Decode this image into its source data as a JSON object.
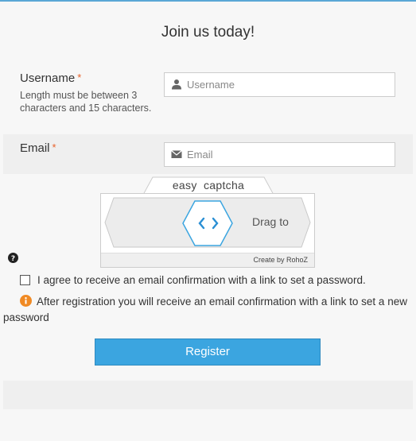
{
  "form": {
    "title": "Join us today!",
    "username": {
      "label": "Username",
      "required_mark": "*",
      "help": "Length must be between 3 characters and 15 characters.",
      "placeholder": "Username",
      "value": "",
      "icon": "user-icon"
    },
    "email": {
      "label": "Email",
      "required_mark": "*",
      "placeholder": "Email",
      "value": "",
      "icon": "envelope-icon"
    },
    "captcha": {
      "title": "easy  captcha",
      "drag_label": "Drag to",
      "credit": "Create by RohoZ"
    },
    "agree_label": "I agree to receive an email confirmation with a link to set a password.",
    "agree_checked": false,
    "info_text": "After registration you will receive an email confirmation with a link to set a new password",
    "register_label": "Register"
  },
  "colors": {
    "accent": "#3ba5e0",
    "required": "#e8622a",
    "info": "#f08a24",
    "handle": "#3ba5e0"
  }
}
